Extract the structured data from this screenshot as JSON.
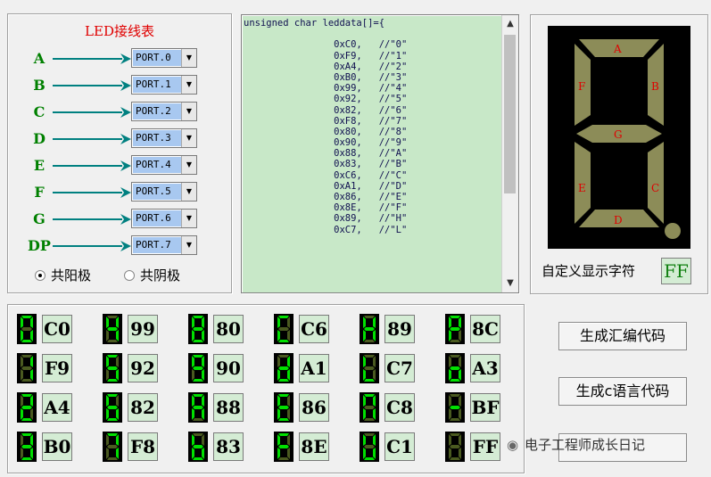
{
  "wiring": {
    "title": "LED接线表",
    "rows": [
      {
        "label": "A",
        "port": "PORT.0"
      },
      {
        "label": "B",
        "port": "PORT.1"
      },
      {
        "label": "C",
        "port": "PORT.2"
      },
      {
        "label": "D",
        "port": "PORT.3"
      },
      {
        "label": "E",
        "port": "PORT.4"
      },
      {
        "label": "F",
        "port": "PORT.5"
      },
      {
        "label": "G",
        "port": "PORT.6"
      },
      {
        "label": "DP",
        "port": "PORT.7"
      }
    ],
    "radio": {
      "anode": "共阳极",
      "cathode": "共阴极",
      "selected": "anode"
    }
  },
  "code": {
    "lines": [
      "unsigned char leddata[]={",
      "",
      "                0xC0,   //\"0\"",
      "                0xF9,   //\"1\"",
      "                0xA4,   //\"2\"",
      "                0xB0,   //\"3\"",
      "                0x99,   //\"4\"",
      "                0x92,   //\"5\"",
      "                0x82,   //\"6\"",
      "                0xF8,   //\"7\"",
      "                0x80,   //\"8\"",
      "                0x90,   //\"9\"",
      "                0x88,   //\"A\"",
      "                0x83,   //\"B\"",
      "                0xC6,   //\"C\"",
      "                0xA1,   //\"D\"",
      "                0x86,   //\"E\"",
      "                0x8E,   //\"F\"",
      "                0x89,   //\"H\"",
      "                0xC7,   //\"L\""
    ]
  },
  "preview": {
    "segments": [
      "A",
      "B",
      "C",
      "D",
      "E",
      "F",
      "G"
    ],
    "custom_label": "自定义显示字符",
    "custom_value": "FF"
  },
  "grid": {
    "columns": [
      [
        "C0",
        "F9",
        "A4",
        "B0"
      ],
      [
        "99",
        "92",
        "82",
        "F8"
      ],
      [
        "80",
        "90",
        "88",
        "83"
      ],
      [
        "C6",
        "A1",
        "86",
        "8E"
      ],
      [
        "89",
        "C7",
        "C8",
        "C1"
      ],
      [
        "8C",
        "A3",
        "BF",
        "FF"
      ]
    ]
  },
  "buttons": {
    "asm": "生成汇编代码",
    "c": "生成c语言代码"
  },
  "watermark": "电子工程师成长日记",
  "colors": {
    "segment_on": "#00e000",
    "segment_off": "#4a5a20",
    "big_segment": "#8c8c58",
    "code_bg": "#c8e8c8",
    "label_green": "#008000",
    "title_red": "#e00000"
  }
}
